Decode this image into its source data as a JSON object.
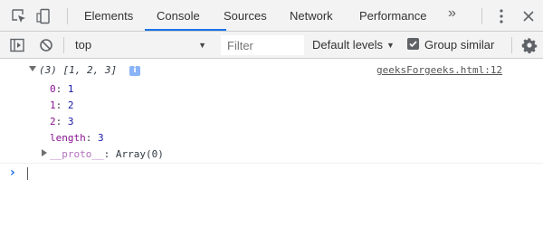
{
  "devtools": {
    "tabs": [
      {
        "label": "Elements"
      },
      {
        "label": "Console"
      },
      {
        "label": "Sources"
      },
      {
        "label": "Network"
      },
      {
        "label": "Performance"
      }
    ],
    "selected_tab": "Console",
    "overflow_label": "»",
    "accent_color": "#1a73e8"
  },
  "toolbar": {
    "context_value": "top",
    "filter_placeholder": "Filter",
    "levels_label": "Default levels",
    "group_similar_label": "Group similar",
    "group_similar_checked": true
  },
  "console": {
    "entry": {
      "summary": "(3) [1, 2, 3]",
      "info_badge": "i",
      "source": "geeksForgeeks.html:12",
      "properties": [
        {
          "key": "0",
          "sep": ": ",
          "value": "1"
        },
        {
          "key": "1",
          "sep": ": ",
          "value": "2"
        },
        {
          "key": "2",
          "sep": ": ",
          "value": "3"
        },
        {
          "key": "length",
          "sep": ": ",
          "value": "3"
        }
      ],
      "proto": {
        "key": "__proto__",
        "sep": ": ",
        "value": "Array(0)"
      }
    },
    "prompt_symbol": "›"
  },
  "icons": {
    "inspect": "inspect-element-icon",
    "device": "device-toolbar-icon",
    "kebab": "more-vert-icon",
    "close": "close-icon",
    "sidebar": "show-sidebar-icon",
    "clear": "clear-console-icon",
    "settings": "gear-icon"
  }
}
